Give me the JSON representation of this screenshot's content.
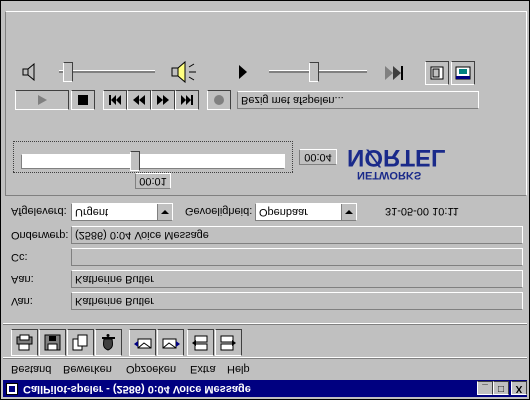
{
  "window": {
    "title": "CallPilot-speler - (2586) 0:04 Voice Message",
    "controls": {
      "minimize": "_",
      "maximize": "□",
      "close": "X"
    }
  },
  "menu": {
    "items": [
      "Bestand",
      "Bewerken",
      "Opzoeken",
      "Extra",
      "Help"
    ]
  },
  "toolbar": {
    "tools": [
      "print-icon",
      "save-icon",
      "copy-icon",
      "alarm-bell-icon",
      "reply-icon",
      "forward-icon",
      "previous-message-icon",
      "next-message-icon"
    ]
  },
  "fields": {
    "from_label": "Van:",
    "from_value": "Katherine Butler",
    "to_label": "Aan:",
    "to_value": "Katherine Butler",
    "cc_label": "Cc:",
    "cc_value": "",
    "subject_label": "Onderwerp:",
    "subject_value": "(2586) 0:04 Voice Message",
    "priority_label": "Afgeleverd:",
    "priority_value": "Urgent",
    "sensitivity_label": "Gevoeligheid:",
    "sensitivity_value": "Openbaar",
    "date_value": "31-05-00 10:11"
  },
  "player": {
    "position_time": "00:01",
    "total_time": "00:04",
    "status_text": "Bezig met afspelen...",
    "volume_level": 0.05,
    "speed_level": 0.45,
    "position_fraction": 0.43
  },
  "logo": {
    "text_top": "NØRTEL",
    "text_bottom": "NETWORKS"
  },
  "colors": {
    "titlebar": "#000080",
    "face": "#c0c0c0",
    "logo": "#1a2a8a"
  }
}
